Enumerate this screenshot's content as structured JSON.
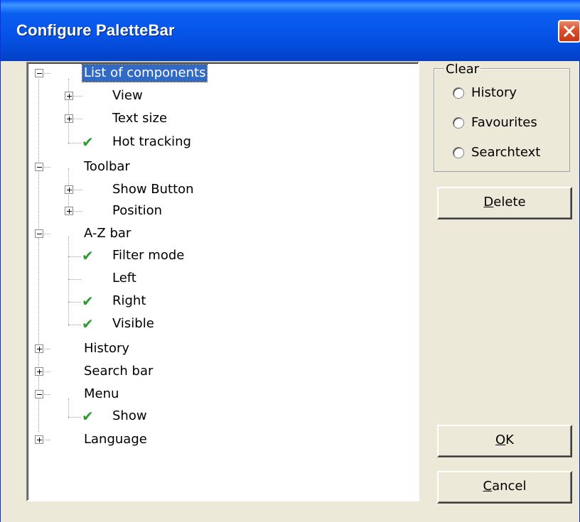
{
  "window": {
    "title": "Configure PaletteBar"
  },
  "tree": {
    "items": [
      {
        "label": "List of components",
        "selected": true
      },
      {
        "label": "View"
      },
      {
        "label": "Text size"
      },
      {
        "label": "Hot tracking",
        "checked": true
      },
      {
        "label": "Toolbar"
      },
      {
        "label": "Show Button"
      },
      {
        "label": "Position"
      },
      {
        "label": "A-Z bar"
      },
      {
        "label": "Filter mode",
        "checked": true
      },
      {
        "label": "Left",
        "checked": false
      },
      {
        "label": "Right",
        "checked": true
      },
      {
        "label": "Visible",
        "checked": true
      },
      {
        "label": "History"
      },
      {
        "label": "Search bar"
      },
      {
        "label": "Menu"
      },
      {
        "label": "Show",
        "checked": true
      },
      {
        "label": "Language"
      }
    ]
  },
  "clear_group": {
    "legend": "Clear",
    "options": [
      "History",
      "Favourites",
      "Searchtext"
    ]
  },
  "buttons": {
    "delete": {
      "first": "D",
      "rest": "elete"
    },
    "ok": {
      "first": "O",
      "rest": "K"
    },
    "cancel": {
      "first": "C",
      "rest": "ancel"
    }
  },
  "colors": {
    "selection": "#316ac5",
    "check": "#2e9b30",
    "titlebar": "#0552e6",
    "dialog_bg": "#ece9d8"
  }
}
